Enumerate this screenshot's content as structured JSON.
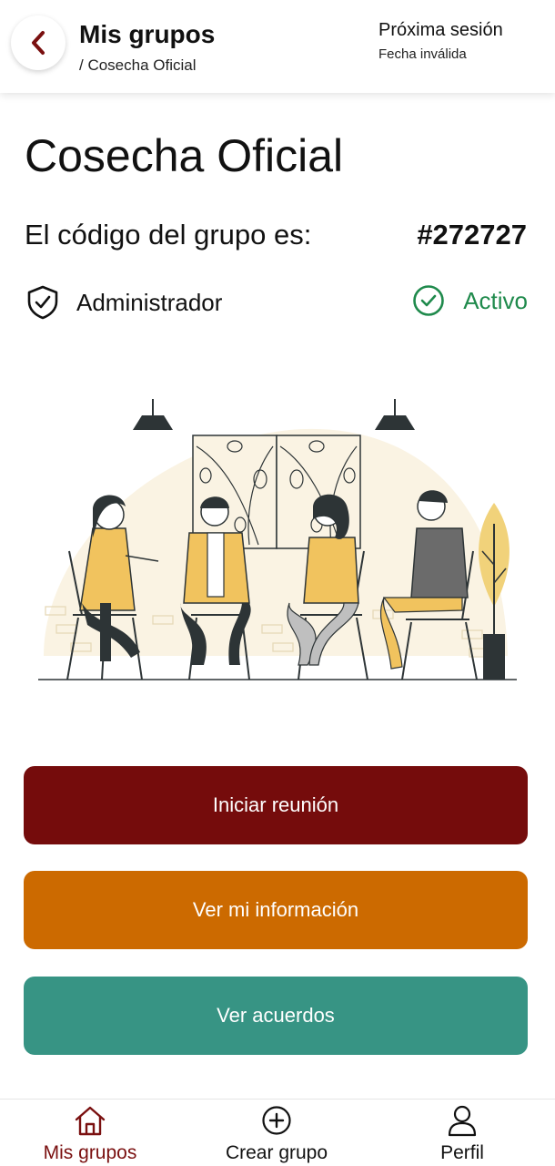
{
  "header": {
    "title": "Mis grupos",
    "breadcrumb": "/ Cosecha Oficial",
    "next_session_label": "Próxima sesión",
    "next_session_value": "Fecha inválida"
  },
  "group": {
    "name": "Cosecha Oficial",
    "code_label": "El código del grupo es:",
    "code_value": "#272727",
    "role": "Administrador",
    "status": "Activo"
  },
  "actions": {
    "start_meeting": "Iniciar reunión",
    "view_info": "Ver mi información",
    "view_agreements": "Ver acuerdos"
  },
  "nav": {
    "groups": "Mis grupos",
    "create": "Crear grupo",
    "profile": "Perfil"
  },
  "colors": {
    "primary": "#750c0c",
    "secondary": "#cc6a00",
    "tertiary": "#379484",
    "active": "#1f8a4c"
  },
  "icons": {
    "back": "chevron-left-icon",
    "role": "shield-check-icon",
    "status": "check-circle-icon",
    "groups": "home-icon",
    "create": "plus-circle-icon",
    "profile": "user-icon"
  }
}
